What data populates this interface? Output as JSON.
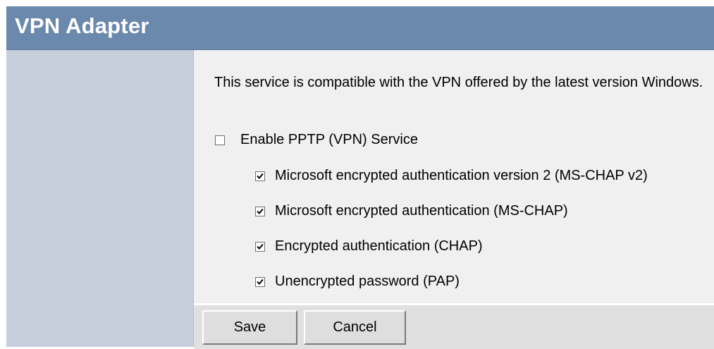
{
  "header": {
    "title": "VPN Adapter"
  },
  "main": {
    "description": "This service is compatible with the VPN offered by the latest version Windows.",
    "enable_pptp": {
      "label": "Enable PPTP (VPN) Service",
      "checked": false
    },
    "auth_options": [
      {
        "label": "Microsoft encrypted authentication version 2 (MS-CHAP v2)",
        "checked": true
      },
      {
        "label": "Microsoft encrypted authentication (MS-CHAP)",
        "checked": true
      },
      {
        "label": "Encrypted authentication (CHAP)",
        "checked": true
      },
      {
        "label": "Unencrypted password (PAP)",
        "checked": true
      }
    ]
  },
  "footer": {
    "save_label": "Save",
    "cancel_label": "Cancel"
  },
  "colors": {
    "title_bar": "#6b88ad",
    "sidebar": "#c7cfdd",
    "content_bg": "#f0f0f0",
    "footer_bg": "#e0e0e0"
  }
}
